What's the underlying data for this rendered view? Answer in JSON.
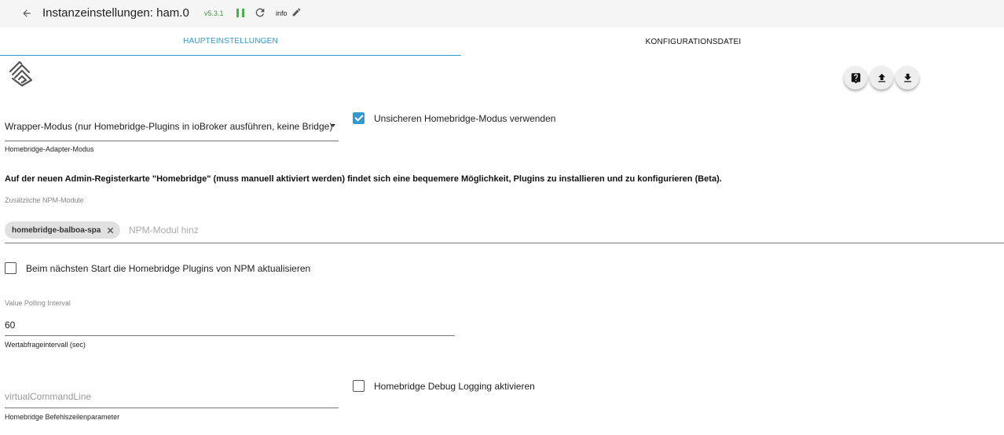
{
  "header": {
    "title": "Instanzeinstellungen: ham.0",
    "version": "v5.3.1",
    "log_level": "info",
    "status_color": "#4caf50"
  },
  "tabs": [
    {
      "label": "HAUPTEINSTELLUNGEN",
      "active": true
    },
    {
      "label": "KONFIGURATIONSDATEI",
      "active": false
    }
  ],
  "actions": {
    "help_icon": "help-icon",
    "upload_icon": "upload-icon",
    "download_icon": "download-icon"
  },
  "form": {
    "adapter_mode": {
      "value": "Wrapper-Modus (nur Homebridge-Plugins in ioBroker ausführen, keine Bridge)",
      "helper": "Homebridge-Adapter-Modus"
    },
    "insecure_mode": {
      "label": "Unsicheren Homebridge-Modus verwenden",
      "checked": true
    },
    "info_text": "Auf der neuen Admin-Registerkarte \"Homebridge\" (muss manuell aktiviert werden) findet sich eine bequemere Möglichkeit, Plugins zu installieren und zu konfigurieren (Beta).",
    "npm_modules": {
      "label": "Zusätzliche NPM-Module",
      "chips": [
        "homebridge-balboa-spa"
      ],
      "placeholder": "NPM-Modul hinz"
    },
    "update_plugins": {
      "label": "Beim nächsten Start die Homebridge Plugins von NPM aktualisieren",
      "checked": false
    },
    "polling_interval": {
      "label": "Value Polling Interval",
      "value": "60",
      "helper": "Wertabfrageintervall (sec)"
    },
    "command_line": {
      "placeholder": "virtualCommandLine",
      "helper": "Homebridge Befehlszeilenparameter"
    },
    "debug_logging": {
      "label": "Homebridge Debug Logging aktivieren",
      "checked": false
    }
  },
  "colors": {
    "accent": "#3399cc",
    "toolbar_bg": "#f5f5f5"
  }
}
